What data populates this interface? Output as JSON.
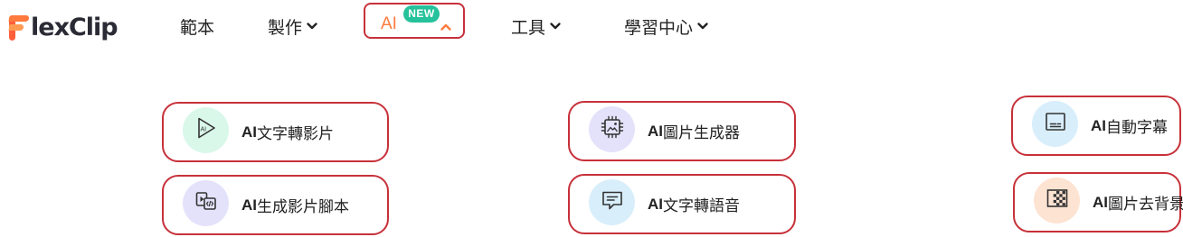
{
  "logo": {
    "text": "lexClip"
  },
  "nav": {
    "templates": "範本",
    "create": "製作",
    "ai": "AI",
    "ai_badge": "NEW",
    "tools": "工具",
    "learning": "學習中心"
  },
  "colors": {
    "accent": "#ff7a3d",
    "badge": "#25c29b",
    "highlight_border": "#c7313a"
  },
  "menu": {
    "items": [
      {
        "prefix": "AI",
        "label": "文字轉影片",
        "icon": "play-text-icon",
        "icon_bg": "#d9f8ea"
      },
      {
        "prefix": "AI",
        "label": "生成影片腳本",
        "icon": "video-script-icon",
        "icon_bg": "#e4e2fb"
      },
      {
        "prefix": "AI",
        "label": "圖片生成器",
        "icon": "ai-chip-image-icon",
        "icon_bg": "#e4e2fb"
      },
      {
        "prefix": "AI",
        "label": "文字轉語音",
        "icon": "speech-bubble-icon",
        "icon_bg": "#d8eefb"
      },
      {
        "prefix": "AI",
        "label": "自動字幕",
        "icon": "subtitle-icon",
        "icon_bg": "#d8eefb"
      },
      {
        "prefix": "AI",
        "label": "圖片去背景",
        "icon": "background-remover-icon",
        "icon_bg": "#fde3d2"
      }
    ]
  }
}
